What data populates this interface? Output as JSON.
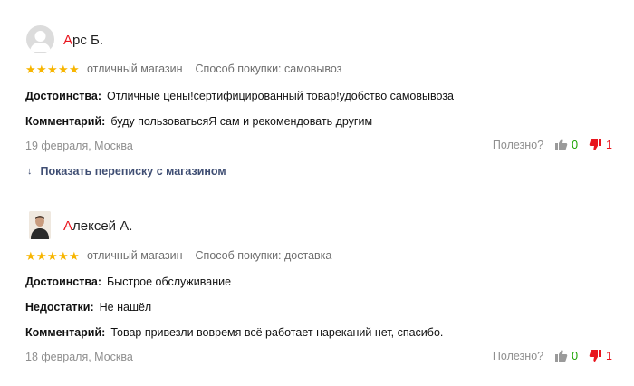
{
  "reviews": [
    {
      "author_initial": "А",
      "author_rest": "рс Б.",
      "rating": 5,
      "rating_text": "отличный магазин",
      "purchase_method": "Способ покупки: самовывоз",
      "fields": [
        {
          "label": "Достоинства:",
          "text": "Отличные цены!сертифицированный товар!удобство самовывоза"
        },
        {
          "label": "Комментарий:",
          "text": "буду пользоватьсяЯ сам и рекомендовать другим"
        }
      ],
      "date": "19 февраля, Москва",
      "helpful_label": "Полезно?",
      "likes": "0",
      "dislikes": "1",
      "show_thread_label": "Показать переписку с магазином"
    },
    {
      "author_initial": "А",
      "author_rest": "лексей А.",
      "rating": 5,
      "rating_text": "отличный магазин",
      "purchase_method": "Способ покупки: доставка",
      "fields": [
        {
          "label": "Достоинства:",
          "text": "Быстрое обслуживание"
        },
        {
          "label": "Недостатки:",
          "text": "Не нашёл"
        },
        {
          "label": "Комментарий:",
          "text": "Товар привезли вовремя всё работает нареканий нет, спасибо."
        }
      ],
      "date": "18 февраля, Москва",
      "helpful_label": "Полезно?",
      "likes": "0",
      "dislikes": "1"
    }
  ],
  "colors": {
    "star": "#f7b500",
    "author_initial": "#e8141d",
    "like_count": "#1aa300",
    "dislike": "#e8141d",
    "link": "#3f4e73"
  },
  "icons": [
    "user-placeholder-icon",
    "star-icon",
    "thumbs-up-icon",
    "thumbs-down-icon",
    "arrow-down-icon"
  ]
}
